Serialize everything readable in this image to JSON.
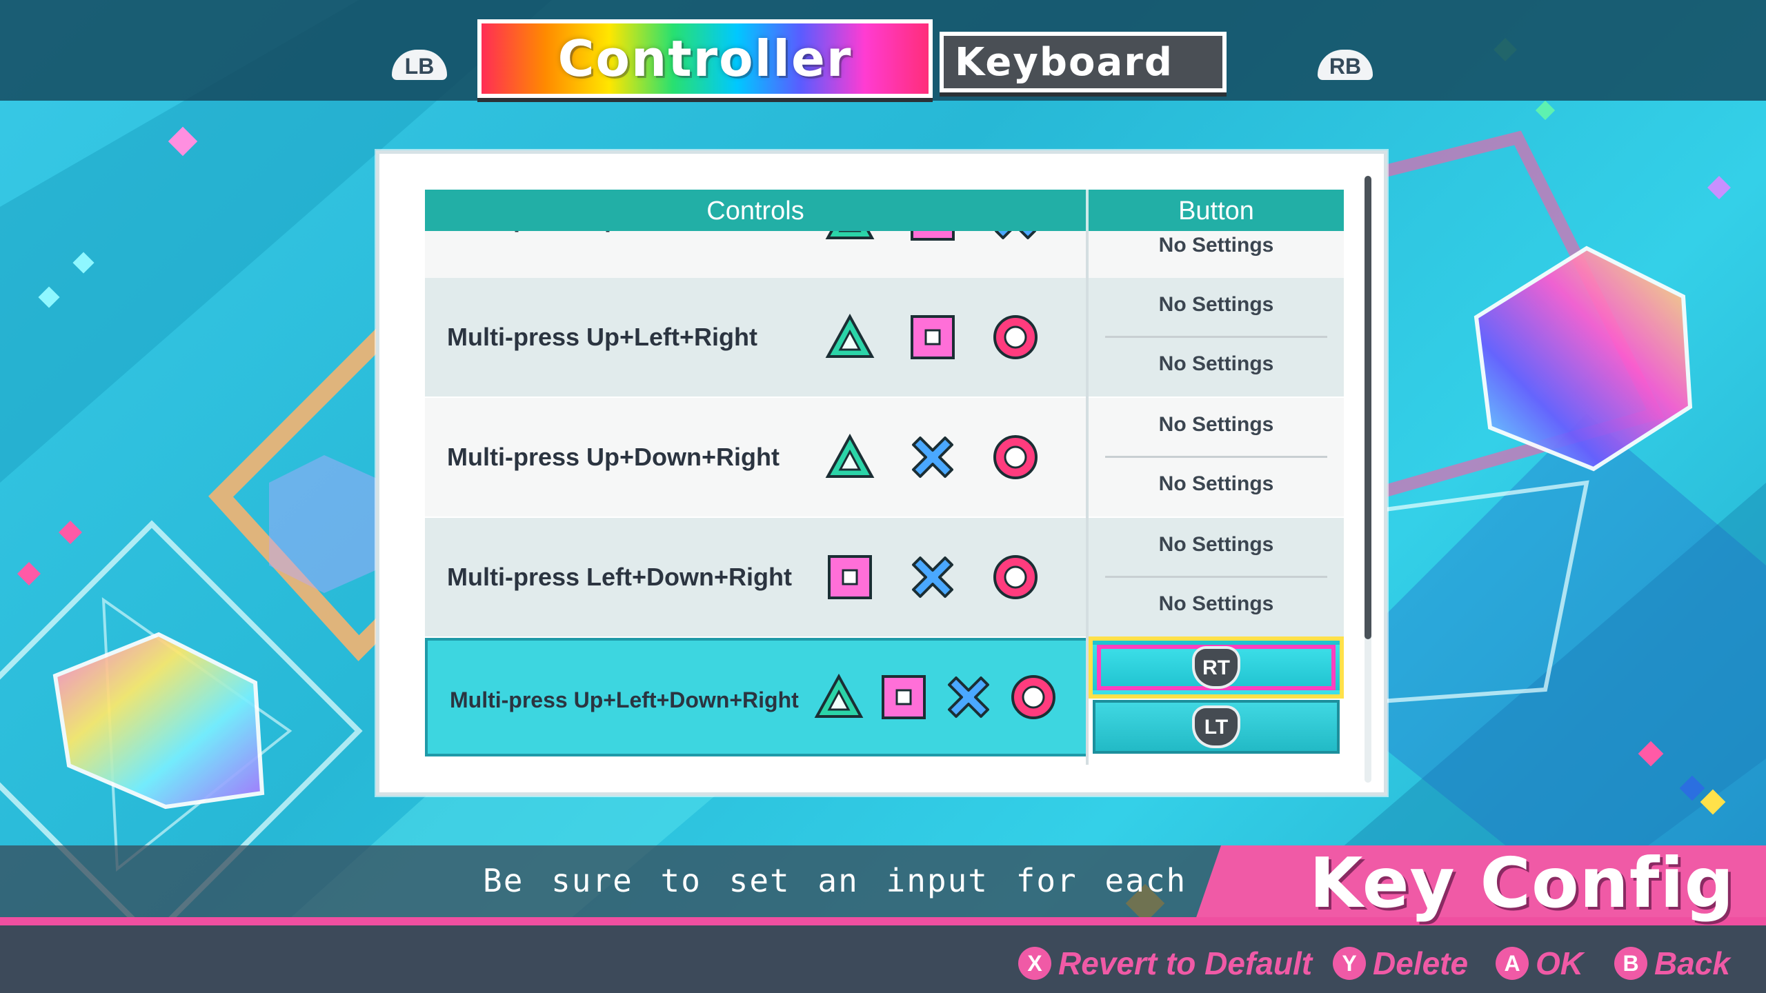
{
  "tabs": {
    "left_shoulder": "LB",
    "right_shoulder": "RB",
    "active": "Controller",
    "inactive": "Keyboard"
  },
  "table": {
    "header_controls": "Controls",
    "header_button": "Button",
    "rows": [
      {
        "label": "Multi-press Up+Left+Down",
        "symbols": [
          "triangle-icon",
          "square-icon",
          "cross-icon"
        ],
        "buttons": [
          "No Settings"
        ]
      },
      {
        "label": "Multi-press Up+Left+Right",
        "symbols": [
          "triangle-icon",
          "square-icon",
          "circle-icon"
        ],
        "buttons": [
          "No Settings",
          "No Settings"
        ]
      },
      {
        "label": "Multi-press Up+Down+Right",
        "symbols": [
          "triangle-icon",
          "cross-icon",
          "circle-icon"
        ],
        "buttons": [
          "No Settings",
          "No Settings"
        ]
      },
      {
        "label": "Multi-press Left+Down+Right",
        "symbols": [
          "square-icon",
          "cross-icon",
          "circle-icon"
        ],
        "buttons": [
          "No Settings",
          "No Settings"
        ]
      },
      {
        "label": "Multi-press Up+Left+Down+Right",
        "symbols": [
          "triangle-icon",
          "square-icon",
          "cross-icon",
          "circle-icon"
        ],
        "buttons": [
          "RT",
          "LT"
        ]
      }
    ]
  },
  "hint_text": "Be sure to set an input for each of the me",
  "screen_title": "Key Config",
  "footer": {
    "revert": {
      "glyph": "X",
      "label": "Revert to Default"
    },
    "delete": {
      "glyph": "Y",
      "label": "Delete"
    },
    "ok": {
      "glyph": "A",
      "label": "OK"
    },
    "back": {
      "glyph": "B",
      "label": "Back"
    }
  },
  "colors": {
    "header_teal": "#22afa6",
    "selected_row": "#3dd6e0",
    "accent_pink": "#f05aa6",
    "triangle": "#2bd4a8",
    "square": "#ff6fd8",
    "cross": "#4aa8ff",
    "circle": "#ff3c7e"
  }
}
